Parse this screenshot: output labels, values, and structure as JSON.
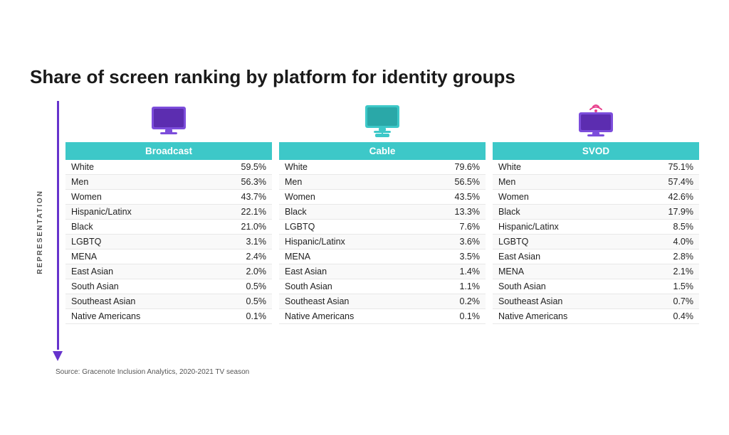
{
  "title": "Share of screen ranking by platform for identity groups",
  "yLabel": "REPRESENTATION",
  "source": "Source: Gracenote Inclusion Analytics, 2020-2021 TV season",
  "platforms": [
    {
      "id": "broadcast",
      "name": "Broadcast",
      "iconType": "broadcast",
      "rows": [
        {
          "group": "White",
          "value": "59.5%"
        },
        {
          "group": "Men",
          "value": "56.3%"
        },
        {
          "group": "Women",
          "value": "43.7%"
        },
        {
          "group": "Hispanic/Latinx",
          "value": "22.1%"
        },
        {
          "group": "Black",
          "value": "21.0%"
        },
        {
          "group": "LGBTQ",
          "value": "3.1%"
        },
        {
          "group": "MENA",
          "value": "2.4%"
        },
        {
          "group": "East Asian",
          "value": "2.0%"
        },
        {
          "group": "South Asian",
          "value": "0.5%"
        },
        {
          "group": "Southeast Asian",
          "value": "0.5%"
        },
        {
          "group": "Native Americans",
          "value": "0.1%"
        }
      ]
    },
    {
      "id": "cable",
      "name": "Cable",
      "iconType": "cable",
      "rows": [
        {
          "group": "White",
          "value": "79.6%"
        },
        {
          "group": "Men",
          "value": "56.5%"
        },
        {
          "group": "Women",
          "value": "43.5%"
        },
        {
          "group": "Black",
          "value": "13.3%"
        },
        {
          "group": "LGBTQ",
          "value": "7.6%"
        },
        {
          "group": "Hispanic/Latinx",
          "value": "3.6%"
        },
        {
          "group": "MENA",
          "value": "3.5%"
        },
        {
          "group": "East Asian",
          "value": "1.4%"
        },
        {
          "group": "South Asian",
          "value": "1.1%"
        },
        {
          "group": "Southeast Asian",
          "value": "0.2%"
        },
        {
          "group": "Native Americans",
          "value": "0.1%"
        }
      ]
    },
    {
      "id": "svod",
      "name": "SVOD",
      "iconType": "svod",
      "rows": [
        {
          "group": "White",
          "value": "75.1%"
        },
        {
          "group": "Men",
          "value": "57.4%"
        },
        {
          "group": "Women",
          "value": "42.6%"
        },
        {
          "group": "Black",
          "value": "17.9%"
        },
        {
          "group": "Hispanic/Latinx",
          "value": "8.5%"
        },
        {
          "group": "LGBTQ",
          "value": "4.0%"
        },
        {
          "group": "East Asian",
          "value": "2.8%"
        },
        {
          "group": "MENA",
          "value": "2.1%"
        },
        {
          "group": "South Asian",
          "value": "1.5%"
        },
        {
          "group": "Southeast Asian",
          "value": "0.7%"
        },
        {
          "group": "Native Americans",
          "value": "0.4%"
        }
      ]
    }
  ]
}
